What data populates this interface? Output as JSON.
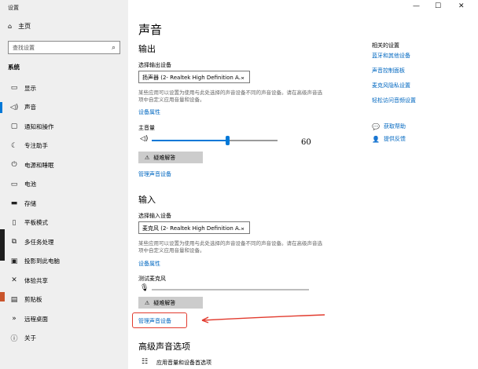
{
  "window": {
    "title": "设置",
    "controls": [
      "—",
      "☐",
      "✕"
    ]
  },
  "sidebar": {
    "home_label": "主页",
    "search_placeholder": "查找设置",
    "section": "系统",
    "items": [
      {
        "label": "显示",
        "icon": "monitor-icon"
      },
      {
        "label": "声音",
        "icon": "speaker-icon"
      },
      {
        "label": "通知和操作",
        "icon": "message-icon"
      },
      {
        "label": "专注助手",
        "icon": "moon-icon"
      },
      {
        "label": "电源和睡眠",
        "icon": "power-icon"
      },
      {
        "label": "电池",
        "icon": "battery-icon"
      },
      {
        "label": "存储",
        "icon": "storage-icon"
      },
      {
        "label": "平板模式",
        "icon": "tablet-icon"
      },
      {
        "label": "多任务处理",
        "icon": "multitask-icon"
      },
      {
        "label": "投影到此电脑",
        "icon": "project-icon"
      },
      {
        "label": "体验共享",
        "icon": "share-icon"
      },
      {
        "label": "剪贴板",
        "icon": "clipboard-icon"
      },
      {
        "label": "远程桌面",
        "icon": "remote-icon"
      },
      {
        "label": "关于",
        "icon": "info-icon"
      }
    ],
    "active_index": 1
  },
  "main": {
    "title": "声音",
    "output": {
      "heading": "输出",
      "device_label": "选择输出设备",
      "device_value": "扬声器 (2- Realtek High Definition A...",
      "note": "某些应用可以设置为使用与此处选择的声音设备不同的声音设备。请在高级声音选项中自定义应用音量和设备。",
      "props_link": "设备属性",
      "volume_label": "主音量",
      "volume_value": "60",
      "volume_level": 0.6,
      "troubleshoot": "疑难解答",
      "manage_link": "管理声音设备"
    },
    "input": {
      "heading": "输入",
      "device_label": "选择输入设备",
      "device_value": "麦克风 (2- Realtek High Definition A...",
      "note": "某些应用可以设置为使用与此处选择的声音设备不同的声音设备。请在高级声音选项中自定义应用音量和设备。",
      "props_link": "设备属性",
      "test_label": "测试麦克风",
      "troubleshoot": "疑难解答",
      "manage_link": "管理声音设备"
    },
    "advanced": {
      "heading": "高级声音选项",
      "item": "应用音量和设备首选项"
    }
  },
  "related": {
    "title": "相关的设置",
    "links": [
      "蓝牙和其他设备",
      "声音控制面板",
      "麦克风隐私设置",
      "轻松访问音频设置"
    ],
    "help": "获取帮助",
    "feedback": "提供反馈"
  },
  "colors": {
    "accent": "#0078d7",
    "link": "#0067c0",
    "highlight": "#e23b2e"
  }
}
